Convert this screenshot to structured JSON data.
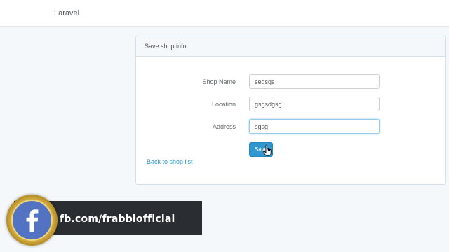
{
  "navbar": {
    "brand": "Laravel"
  },
  "panel": {
    "title": "Save shop info",
    "fields": [
      {
        "label": "Shop Name",
        "value": "segsgs"
      },
      {
        "label": "Location",
        "value": "gsgsdgsg"
      },
      {
        "label": "Address",
        "value": "sgsg"
      }
    ],
    "save_label": "Save",
    "back_link": "Back to shop list"
  },
  "overlay": {
    "social_icon": "facebook-icon",
    "social_text": "fb.com/frabbiofficial",
    "colors": {
      "facebook_blue": "#5173c1",
      "ring_gold": "#d9b54a",
      "banner_bg": "#2a2d31"
    }
  },
  "colors": {
    "primary": "#3097d1",
    "page_bg": "#f5f8fa"
  }
}
